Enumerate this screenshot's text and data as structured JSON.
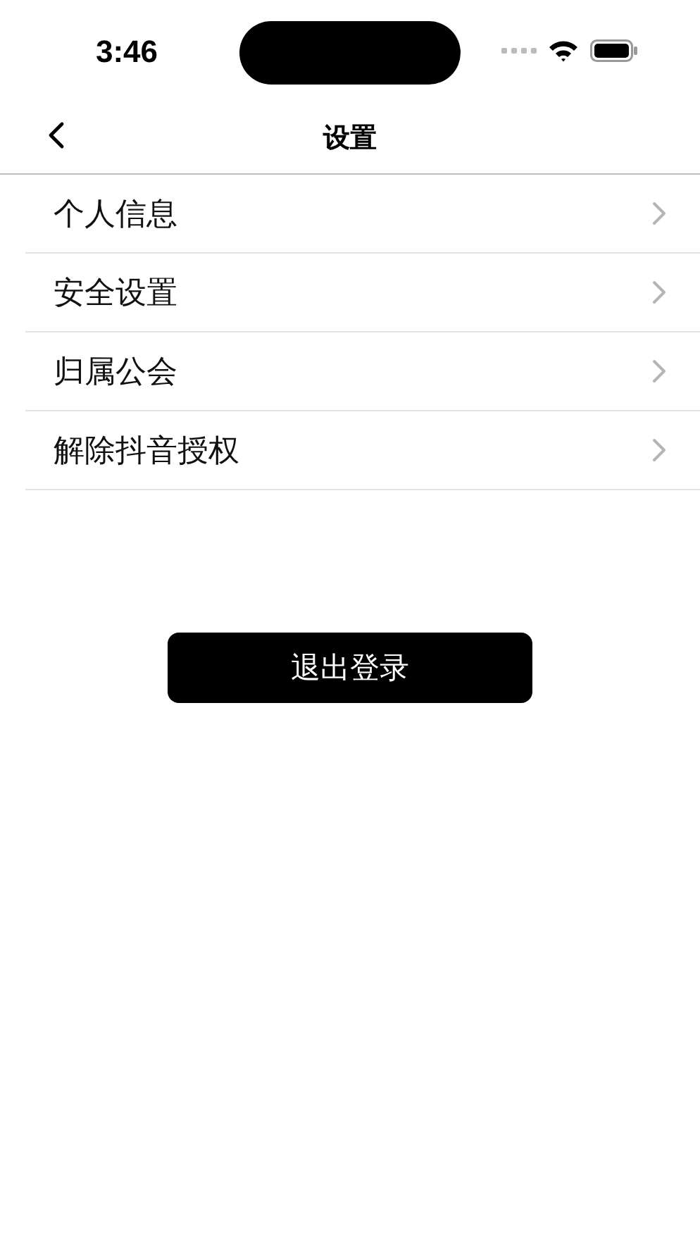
{
  "status_bar": {
    "time": "3:46"
  },
  "nav": {
    "title": "设置"
  },
  "items": [
    {
      "label": "个人信息"
    },
    {
      "label": "安全设置"
    },
    {
      "label": "归属公会"
    },
    {
      "label": "解除抖音授权"
    }
  ],
  "logout_button": "退出登录"
}
